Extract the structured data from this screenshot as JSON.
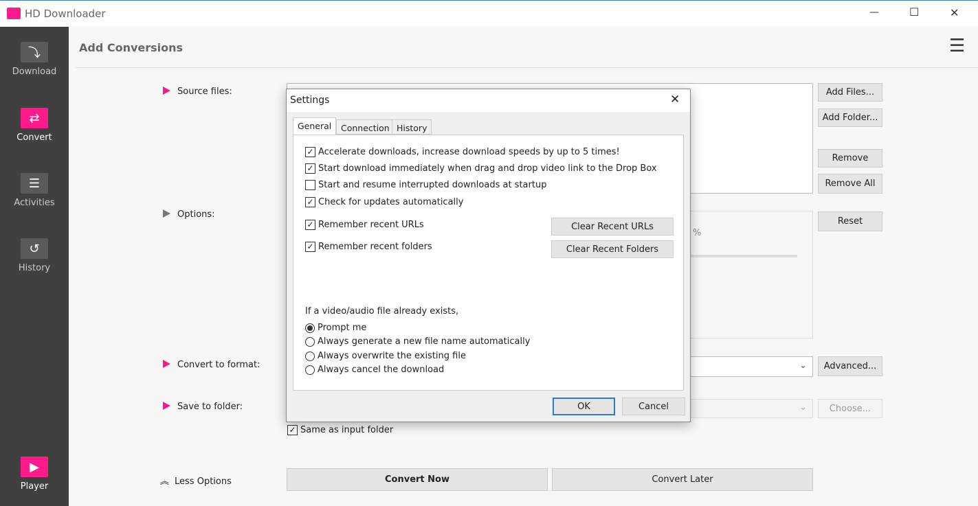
{
  "window": {
    "title": "HD Downloader",
    "minimize": "—",
    "maximize": "☐",
    "close": "✕"
  },
  "sidebar": {
    "items": [
      {
        "label": "Download",
        "icon": "download-icon"
      },
      {
        "label": "Convert",
        "icon": "convert-icon",
        "active": true
      },
      {
        "label": "Activities",
        "icon": "list-icon"
      },
      {
        "label": "History",
        "icon": "history-icon"
      },
      {
        "label": "Player",
        "icon": "play-icon"
      }
    ]
  },
  "header": {
    "title": "Add Conversions",
    "menu_icon": "☰"
  },
  "main": {
    "source_files_label": "Source files:",
    "options_label": "Options:",
    "convert_to_format_label": "Convert to format:",
    "save_to_folder_label": "Save to folder:",
    "same_as_input": "Same as input folder",
    "same_as_input_checked": true,
    "options_percent": "%",
    "less_options": "Less Options",
    "buttons": {
      "add_files": "Add Files...",
      "add_folder": "Add Folder...",
      "remove": "Remove",
      "remove_all": "Remove All",
      "reset": "Reset",
      "advanced": "Advanced...",
      "choose": "Choose...",
      "convert_now": "Convert Now",
      "convert_later": "Convert Later"
    }
  },
  "dialog": {
    "title": "Settings",
    "tabs": [
      "General",
      "Connection",
      "History"
    ],
    "active_tab": "General",
    "checkboxes": [
      {
        "label": "Accelerate downloads, increase download speeds by up to 5 times!",
        "checked": true
      },
      {
        "label": "Start download immediately when drag and drop video link to the Drop Box",
        "checked": true
      },
      {
        "label": "Start and resume interrupted downloads at startup",
        "checked": false
      },
      {
        "label": "Check for updates automatically",
        "checked": true
      },
      {
        "label": "Remember recent URLs",
        "checked": true
      },
      {
        "label": "Remember recent folders",
        "checked": true
      }
    ],
    "clear_urls": "Clear Recent URLs",
    "clear_folders": "Clear Recent Folders",
    "exists_label": "If a video/audio file already exists,",
    "radios": [
      {
        "label": "Prompt me",
        "selected": true
      },
      {
        "label": "Always generate a new file name automatically",
        "selected": false
      },
      {
        "label": "Always overwrite the existing file",
        "selected": false
      },
      {
        "label": "Always cancel the download",
        "selected": false
      }
    ],
    "ok": "OK",
    "cancel": "Cancel"
  },
  "colors": {
    "accent": "#ff1a8c",
    "sidebar": "#404040"
  }
}
